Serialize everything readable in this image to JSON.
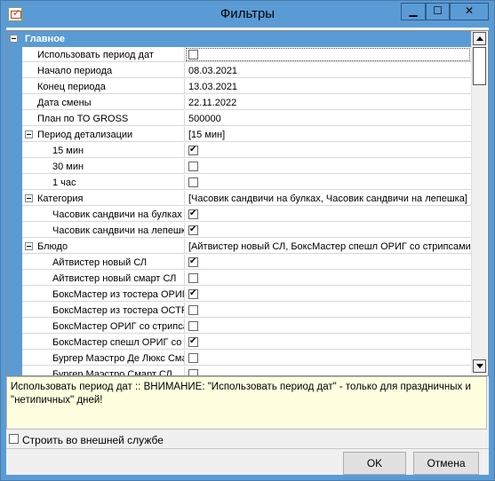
{
  "window": {
    "title": "Фильтры"
  },
  "titlebar_buttons": {
    "minimize": "▁",
    "maximize": "☐",
    "close": "✕"
  },
  "category": {
    "label": "Главное"
  },
  "rows": [
    {
      "name": "Использовать период дат",
      "value": ""
    },
    {
      "name": "Начало периода",
      "value": "08.03.2021"
    },
    {
      "name": "Конец периода",
      "value": "13.03.2021"
    },
    {
      "name": "Дата смены",
      "value": "22.11.2022"
    },
    {
      "name": "План по ТО GROSS",
      "value": "500000"
    },
    {
      "name": "Период детализации",
      "value": "[15 мин]"
    },
    {
      "name": "15 мин",
      "value": ""
    },
    {
      "name": "30 мин",
      "value": ""
    },
    {
      "name": "1 час",
      "value": ""
    },
    {
      "name": "Категория",
      "value": "[Часовик сандвичи на булках, Часовик сандвичи на лепешка]"
    },
    {
      "name": "Часовик сандвичи на булках",
      "value": ""
    },
    {
      "name": "Часовик сандвичи на лепешках",
      "value": ""
    },
    {
      "name": "Блюдо",
      "value": "[Айтвистер новый СЛ, БоксМастер спешл ОРИГ со стрипсами СЛ]"
    },
    {
      "name": "Айтвистер новый СЛ",
      "value": ""
    },
    {
      "name": "Айтвистер новый смарт СЛ",
      "value": ""
    },
    {
      "name": "БоксМастер из тостера ОРИГ",
      "value": ""
    },
    {
      "name": "БоксМастер из тостера ОСТР",
      "value": ""
    },
    {
      "name": "БоксМастер ОРИГ со стрипсами",
      "value": ""
    },
    {
      "name": "БоксМастер спешл ОРИГ со стрипсами",
      "value": ""
    },
    {
      "name": "Бургер Маэстро Де Люкс Смак",
      "value": ""
    },
    {
      "name": "Бургер Маэстро Смарт СЛ",
      "value": ""
    }
  ],
  "checks": {
    "use_period": false,
    "min15": true,
    "min30": false,
    "hour1": false,
    "cat_buns": true,
    "cat_flatbread": true,
    "dish_1": true,
    "dish_2": false,
    "dish_3": true,
    "dish_4": false,
    "dish_5": false,
    "dish_6": true,
    "dish_7": false,
    "dish_8": false,
    "build_external": false
  },
  "description": "Использовать период дат :: ВНИМАНИЕ: \"Использовать период дат\" - только для праздничных и \"нетипичных\" дней!",
  "external_service_label": "Строить во внешней службе",
  "buttons": {
    "ok": "OK",
    "cancel": "Отмена"
  },
  "colors": {
    "title_bar": "#5b9bd5",
    "description_bg": "#ffffe0"
  }
}
